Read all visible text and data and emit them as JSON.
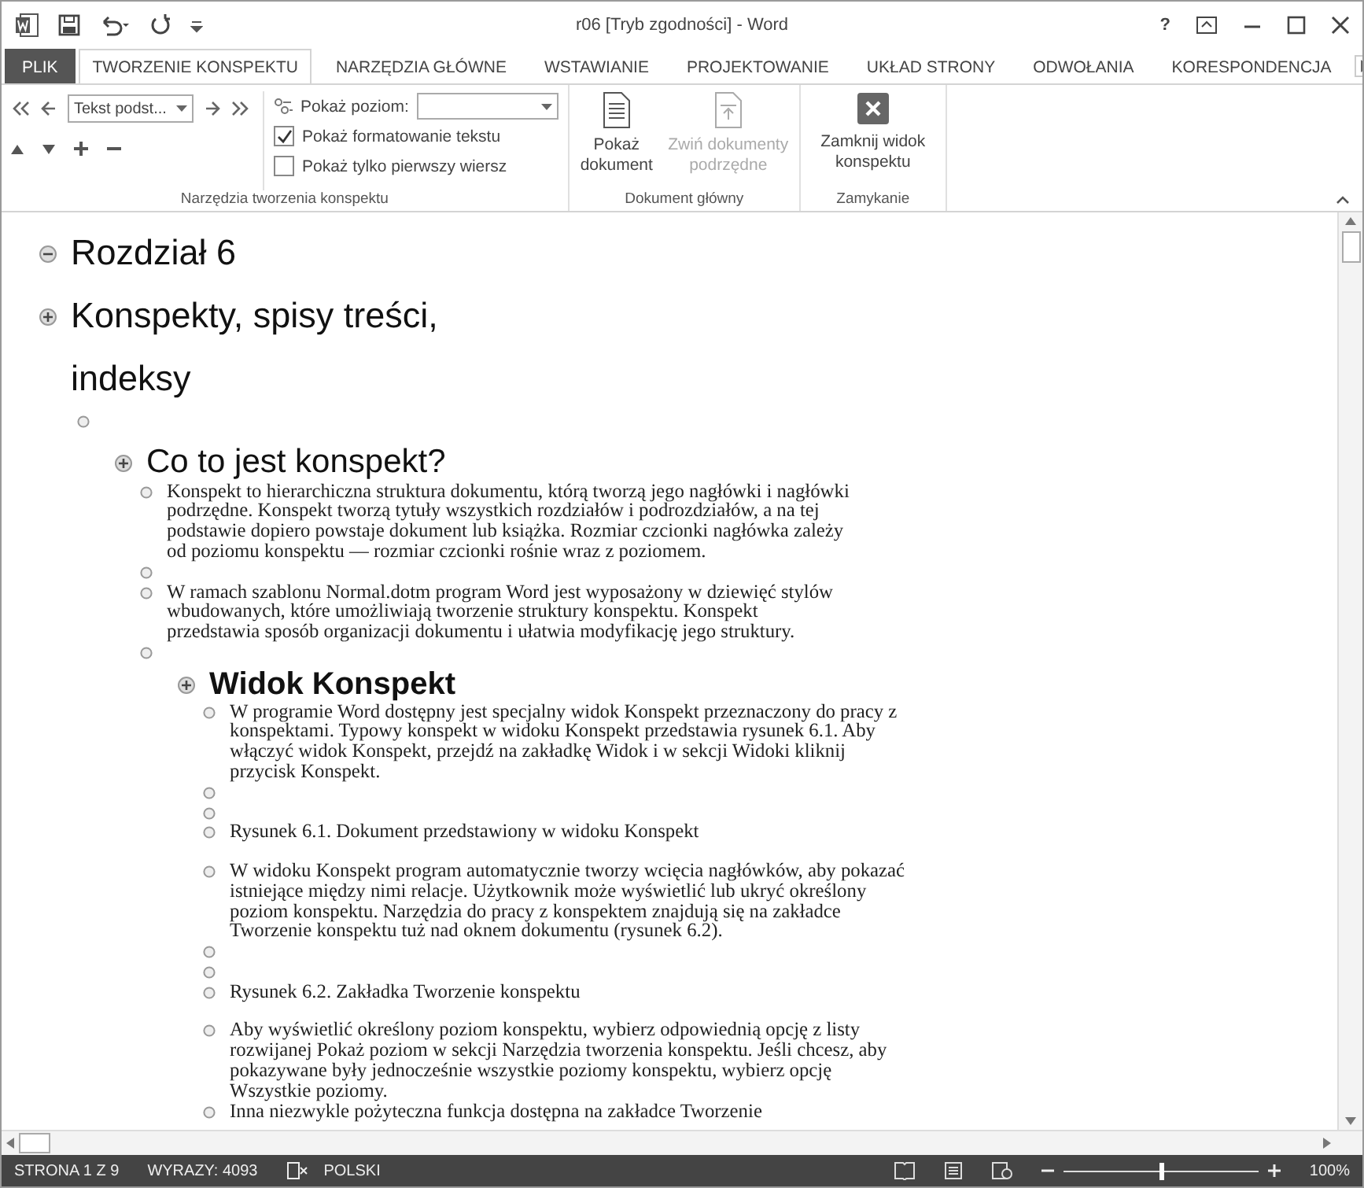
{
  "window": {
    "title": "r06 [Tryb zgodności] - Word",
    "help": "?"
  },
  "tabs": [
    {
      "label": "PLIK",
      "kind": "file",
      "selected": false
    },
    {
      "label": "TWORZENIE KONSPEKTU",
      "kind": "tab",
      "selected": true
    },
    {
      "label": "NARZĘDZIA GŁÓWNE",
      "kind": "tab",
      "selected": false
    },
    {
      "label": "WSTAWIANIE",
      "kind": "tab",
      "selected": false
    },
    {
      "label": "PROJEKTOWANIE",
      "kind": "tab",
      "selected": false
    },
    {
      "label": "UKŁAD STRONY",
      "kind": "tab",
      "selected": false
    },
    {
      "label": "ODWOŁANIA",
      "kind": "tab",
      "selected": false
    },
    {
      "label": "KORESPONDENCJA",
      "kind": "tab",
      "selected": false
    }
  ],
  "ribbon": {
    "outline_tools": {
      "style_select": "Tekst podst...",
      "show_level_label": "Pokaż poziom:",
      "checkboxes": [
        {
          "label": "Pokaż formatowanie tekstu",
          "checked": true
        },
        {
          "label": "Pokaż tylko pierwszy wiersz",
          "checked": false
        }
      ],
      "group_label": "Narzędzia tworzenia konspektu"
    },
    "master_document": {
      "buttons": [
        {
          "label": "Pokaż dokument",
          "disabled": false
        },
        {
          "label": "Zwiń dokumenty podrzędne",
          "disabled": true
        }
      ],
      "group_label": "Dokument główny"
    },
    "close": {
      "button": "Zamknij widok konspektu",
      "group_label": "Zamykanie"
    }
  },
  "outline": [
    {
      "kind": "h1",
      "text": "Rozdział 6"
    },
    {
      "kind": "h1",
      "text": "Konspekty, spisy treści, indeksy",
      "children": [
        {
          "kind": "body"
        },
        {
          "kind": "h2",
          "text": "Co to jest konspekt?",
          "children": [
            {
              "kind": "body",
              "text": "Konspekt to hierarchiczna struktura dokumentu, którą tworzą jego nagłówki i nagłówki podrzędne. Konspekt tworzą tytuły wszystkich rozdziałów i podrozdziałów, a na tej podstawie dopiero powstaje dokument lub książka. Rozmiar czcionki nagłówka zależy od poziomu konspektu — rozmiar czcionki rośnie wraz z poziomem."
            },
            {
              "kind": "body"
            },
            {
              "kind": "body",
              "text": "W ramach szablonu Normal.dotm program Word jest wyposażony w dziewięć stylów wbudowanych, które umożliwiają tworzenie struktury konspektu. Konspekt przedstawia sposób organizacji dokumentu i ułatwia modyfikację jego struktury."
            },
            {
              "kind": "body"
            },
            {
              "kind": "h3",
              "text": "Widok Konspekt",
              "children": [
                {
                  "kind": "body",
                  "text": "W programie Word dostępny jest specjalny widok Konspekt przeznaczony do pracy z konspektami. Typowy konspekt w widoku Konspekt przedstawia rysunek 6.1. Aby włączyć widok Konspekt, przejdź na zakładkę Widok i w sekcji Widoki kliknij przycisk Konspekt."
                },
                {
                  "kind": "body"
                },
                {
                  "kind": "body"
                },
                {
                  "kind": "caption",
                  "text": "Rysunek 6.1. Dokument przedstawiony w widoku Konspekt"
                },
                {
                  "kind": "body",
                  "text": "W widoku Konspekt program automatycznie tworzy wcięcia nagłówków, aby pokazać istniejące między nimi relacje. Użytkownik może wyświetlić lub ukryć określony poziom konspektu. Narzędzia do pracy z konspektem znajdują się na zakładce Tworzenie konspektu tuż nad oknem dokumentu (rysunek 6.2)."
                },
                {
                  "kind": "body"
                },
                {
                  "kind": "body"
                },
                {
                  "kind": "caption",
                  "text": "Rysunek 6.2. Zakładka Tworzenie konspektu"
                },
                {
                  "kind": "body",
                  "text": "Aby wyświetlić określony poziom konspektu, wybierz odpowiednią opcję z listy rozwijanej Pokaż poziom w sekcji Narzędzia tworzenia konspektu. Jeśli chcesz, aby pokazywane były jednocześnie wszystkie poziomy konspektu, wybierz opcję Wszystkie poziomy."
                },
                {
                  "kind": "body",
                  "text": "Inna niezwykle pożyteczna funkcja dostępna na zakładce Tworzenie"
                }
              ]
            }
          ]
        }
      ]
    }
  ],
  "status_bar": {
    "page": "STRONA 1 Z 9",
    "words": "WYRAZY: 4093",
    "language": "POLSKI",
    "zoom": {
      "level": 0.5,
      "reading": "100%"
    }
  }
}
